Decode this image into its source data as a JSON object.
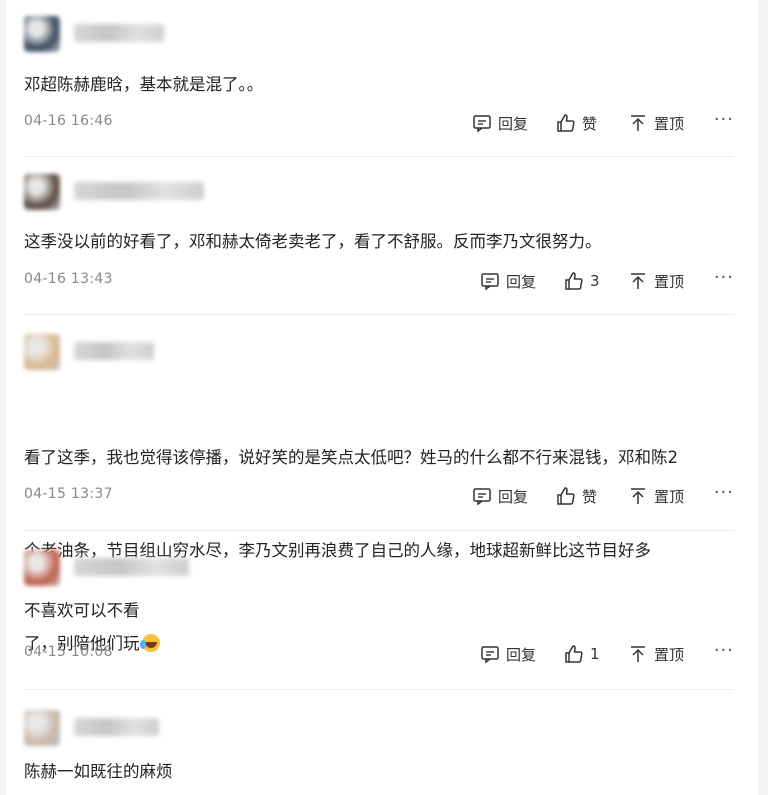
{
  "comments": [
    {
      "avatar_color": "#3a4a5e",
      "text": "邓超陈赫鹿晗，基本就是混了。。",
      "time": "04-16 16:46",
      "reply_label": "回复",
      "like_label": "赞",
      "pin_label": "置顶",
      "more_label": "···"
    },
    {
      "avatar_color": "#5a4a40",
      "text": "这季没以前的好看了，邓和赫太倚老卖老了，看了不舒服。反而李乃文很努力。",
      "time": "04-16 13:43",
      "reply_label": "回复",
      "like_label": "3",
      "pin_label": "置顶",
      "more_label": "···"
    },
    {
      "avatar_color": "#d9b98c",
      "text_lines": [
        "看了这季，我也觉得该停播，说好笑的是笑点太低吧？姓马的什么都不行来混钱，邓和陈2",
        "个老油条，节目组山穷水尽，李乃文别再浪费了自己的人缘，地球超新鲜比这节目好多",
        "了，别陪他们玩"
      ],
      "emoji": "crying-laughing-face",
      "time": "04-15 13:37",
      "reply_label": "回复",
      "like_label": "赞",
      "pin_label": "置顶",
      "more_label": "···"
    },
    {
      "avatar_color": "#c0604a",
      "text": "不喜欢可以不看",
      "time": "04-15 10:08",
      "reply_label": "回复",
      "like_label": "1",
      "pin_label": "置顶",
      "more_label": "···"
    },
    {
      "avatar_color": "#c9b8aa",
      "text": "陈赫一如既往的麻烦"
    }
  ],
  "icons": {
    "reply": "comment-icon",
    "like": "thumbs-up-icon",
    "pin": "pin-to-top-icon",
    "more": "more-icon"
  }
}
